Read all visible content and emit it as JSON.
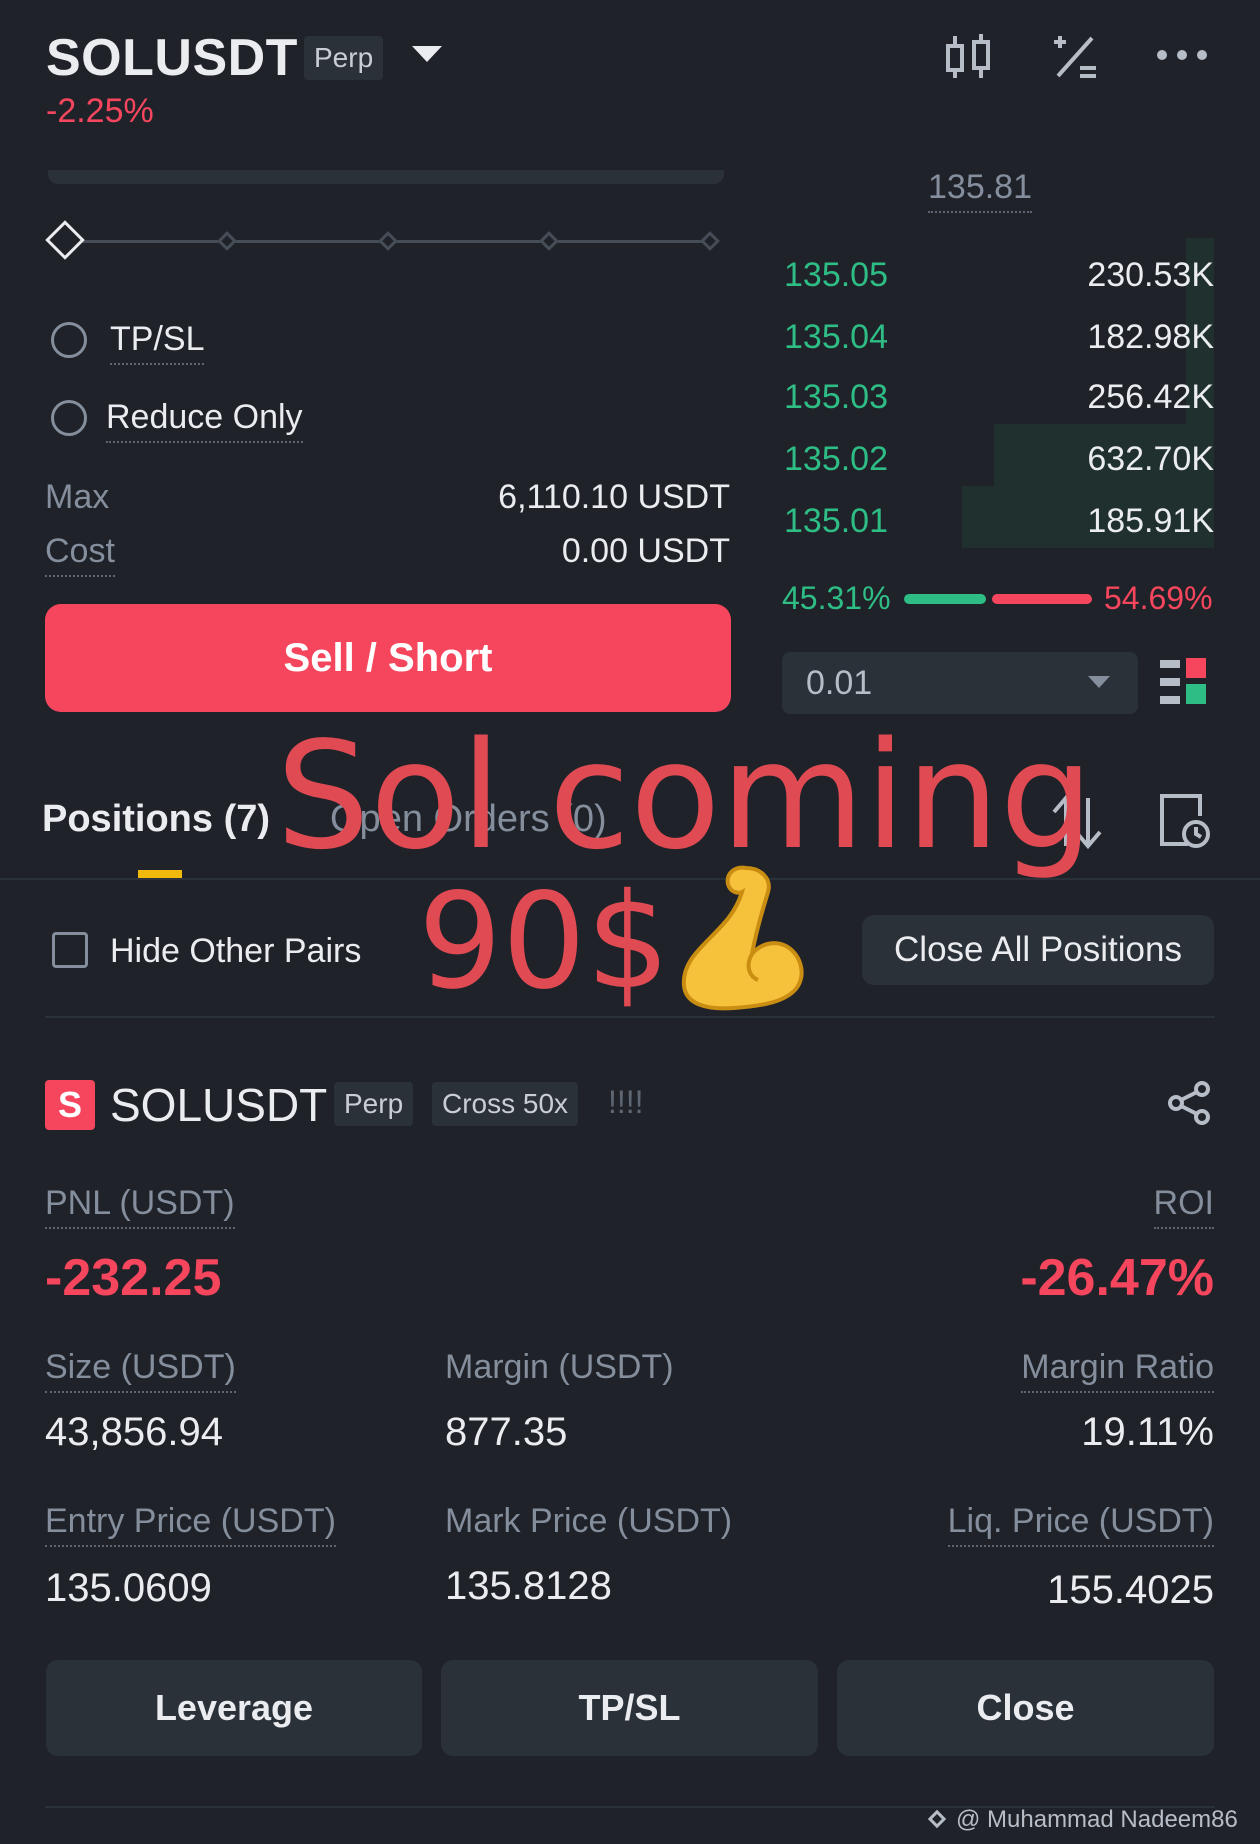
{
  "header": {
    "symbol": "SOLUSDT",
    "contract_type": "Perp",
    "change_pct": "-2.25%"
  },
  "order_form": {
    "tpsl_label": "TP/SL",
    "reduce_only_label": "Reduce Only",
    "max_label": "Max",
    "max_value": "6,110.10 USDT",
    "cost_label": "Cost",
    "cost_value": "0.00 USDT",
    "sell_button": "Sell / Short",
    "slider_level": 0
  },
  "orderbook": {
    "last_price": "135.81",
    "rows": [
      {
        "price": "135.05",
        "qty": "230.53K"
      },
      {
        "price": "135.04",
        "qty": "182.98K"
      },
      {
        "price": "135.03",
        "qty": "256.42K"
      },
      {
        "price": "135.02",
        "qty": "632.70K"
      },
      {
        "price": "135.01",
        "qty": "185.91K"
      }
    ],
    "buy_pct": "45.31%",
    "sell_pct": "54.69%",
    "precision": "0.01"
  },
  "tabs": {
    "positions": "Positions (7)",
    "open_orders": "Open Orders (0)"
  },
  "filters": {
    "hide_other_pairs": "Hide Other Pairs",
    "close_all": "Close All Positions"
  },
  "position": {
    "badge": "S",
    "symbol": "SOLUSDT",
    "type": "Perp",
    "margin_mode": "Cross 50x",
    "warning": "!!!!",
    "pnl_label": "PNL (USDT)",
    "pnl_value": "-232.25",
    "roi_label": "ROI",
    "roi_value": "-26.47%",
    "size_label": "Size (USDT)",
    "size_value": "43,856.94",
    "margin_label": "Margin (USDT)",
    "margin_value": "877.35",
    "margin_ratio_label": "Margin Ratio",
    "margin_ratio_value": "19.11%",
    "entry_label": "Entry Price (USDT)",
    "entry_value": "135.0609",
    "mark_label": "Mark Price (USDT)",
    "mark_value": "135.8128",
    "liq_label": "Liq. Price (USDT)",
    "liq_value": "155.4025"
  },
  "actions": {
    "leverage": "Leverage",
    "tpsl": "TP/SL",
    "close": "Close"
  },
  "overlay": {
    "line1": "Sol coming",
    "line2": "90$"
  },
  "watermark": "@ Muhammad Nadeem86"
}
